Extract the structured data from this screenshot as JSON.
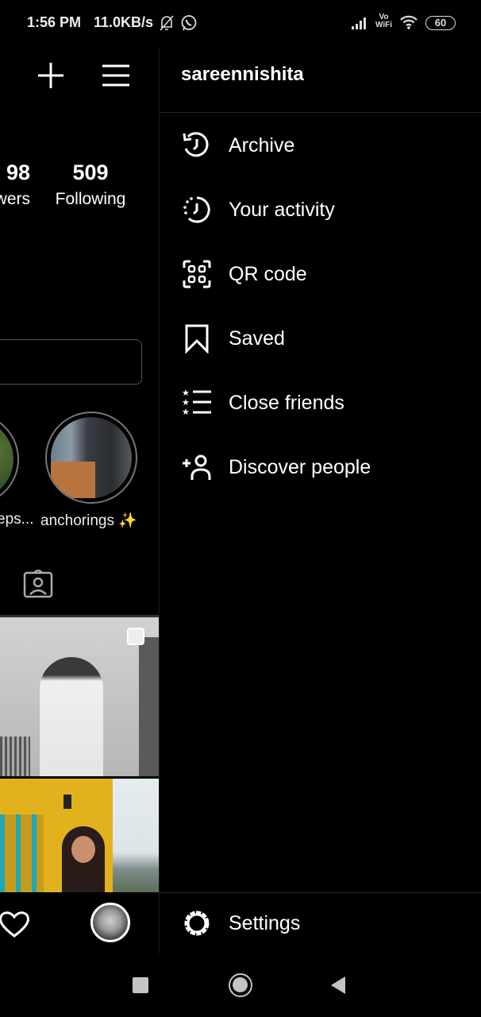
{
  "status_bar": {
    "time": "1:56 PM",
    "net_speed": "11.0KB/s",
    "icons": [
      "bell-off-icon",
      "whatsapp-icon"
    ],
    "right_icons": [
      "signal-icon",
      "vowifi-icon",
      "wifi-icon"
    ],
    "vowifi_top": "Vo",
    "vowifi_bottom": "WiFi",
    "battery": "60"
  },
  "profile": {
    "header_icons": [
      "plus-icon",
      "menu-icon"
    ],
    "followers_count": "98",
    "followers_label": "wers",
    "following_count": "509",
    "following_label": "Following",
    "stories": [
      {
        "label": "eps..."
      },
      {
        "label": "anchorings ✨"
      }
    ],
    "tagged_icon": "tagged-icon",
    "bottom_nav": [
      "heart-icon",
      "profile-avatar"
    ]
  },
  "drawer": {
    "username": "sareennishita",
    "items": [
      {
        "label": "Archive",
        "icon": "archive-icon"
      },
      {
        "label": "Your activity",
        "icon": "activity-icon"
      },
      {
        "label": "QR code",
        "icon": "qr-code-icon"
      },
      {
        "label": "Saved",
        "icon": "bookmark-icon"
      },
      {
        "label": "Close friends",
        "icon": "close-friends-icon"
      },
      {
        "label": "Discover people",
        "icon": "add-person-icon"
      }
    ],
    "settings_label": "Settings"
  },
  "system_nav": [
    "recents-button",
    "home-button",
    "back-button"
  ]
}
